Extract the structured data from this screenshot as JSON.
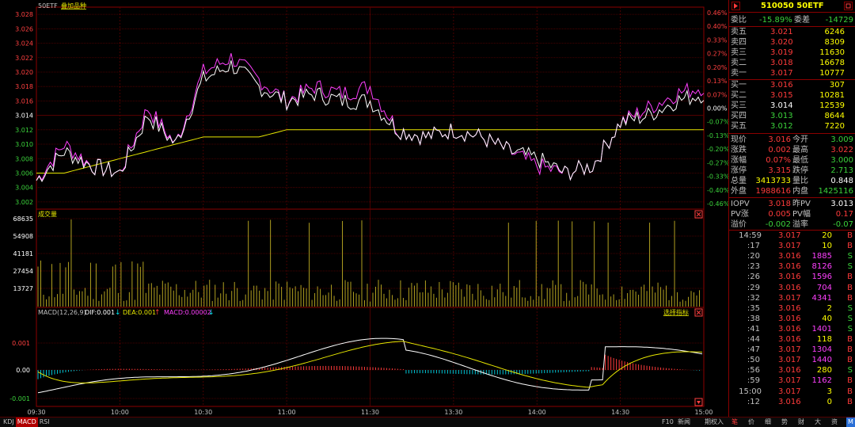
{
  "chart_header": {
    "code": "50ETF",
    "overlay_label": "叠加品种"
  },
  "volume_title": "成交量",
  "macd_title": "MACD(12,26,9)",
  "dif_label": "DIF:0.001",
  "dea_label": "DEA:0.001",
  "macd_label": "MACD:0.00002",
  "indicator_select": "选择指标",
  "price_axis": [
    "3.028",
    "3.026",
    "3.024",
    "3.022",
    "3.020",
    "3.018",
    "3.016",
    "3.014",
    "3.012",
    "3.010",
    "3.008",
    "3.006",
    "3.004",
    "3.002"
  ],
  "pct_axis": [
    "0.46%",
    "0.40%",
    "0.33%",
    "0.27%",
    "0.20%",
    "0.13%",
    "0.07%",
    "0.00%",
    "-0.07%",
    "-0.13%",
    "-0.20%",
    "-0.27%",
    "-0.33%",
    "-0.40%",
    "-0.46%"
  ],
  "volume_axis": [
    "68635",
    "54908",
    "41181",
    "27454",
    "13727"
  ],
  "macd_axis": [
    "0.001",
    "0.00",
    "-0.001"
  ],
  "time_axis": [
    "09:30",
    "10:00",
    "10:30",
    "11:00",
    "11:30",
    "13:30",
    "14:00",
    "14:30",
    "15:00"
  ],
  "chart_data": {
    "type": "line",
    "x": [
      "09:30",
      "09:40",
      "09:50",
      "10:00",
      "10:10",
      "10:20",
      "10:30",
      "10:40",
      "10:50",
      "11:00",
      "11:10",
      "11:20",
      "11:30",
      "13:10",
      "13:20",
      "13:30",
      "13:40",
      "13:50",
      "14:00",
      "14:10",
      "14:20",
      "14:30",
      "14:40",
      "14:50",
      "15:00"
    ],
    "series": [
      {
        "values": [
          3.005,
          3.009,
          3.007,
          3.006,
          3.014,
          3.01,
          3.019,
          3.021,
          3.018,
          3.016,
          3.017,
          3.016,
          3.016,
          3.012,
          3.011,
          3.012,
          3.011,
          3.009,
          3.008,
          3.006,
          3.007,
          3.013,
          3.014,
          3.016,
          3.017
        ]
      },
      {
        "values": [
          3.005,
          3.01,
          3.007,
          3.006,
          3.015,
          3.01,
          3.02,
          3.022,
          3.019,
          3.016,
          3.018,
          3.017,
          3.018,
          3.012,
          3.011,
          3.012,
          3.011,
          3.009,
          3.007,
          3.006,
          3.007,
          3.013,
          3.015,
          3.017,
          3.018
        ]
      },
      {
        "values": [
          3.006,
          3.006,
          3.007,
          3.008,
          3.009,
          3.01,
          3.011,
          3.011,
          3.011,
          3.012,
          3.012,
          3.012,
          3.012,
          3.012,
          3.012,
          3.012,
          3.012,
          3.012,
          3.012,
          3.012,
          3.012,
          3.012,
          3.012,
          3.012,
          3.012
        ]
      }
    ],
    "ylim": [
      3.001,
      3.029
    ]
  },
  "quote": {
    "code_name": "510050 50ETF",
    "weibi_label": "委比",
    "weibi_value": "-15.89%",
    "weicha_label": "委差",
    "weicha_value": "-14729",
    "asks": [
      {
        "label": "卖五",
        "price": "3.021",
        "vol": "6246"
      },
      {
        "label": "卖四",
        "price": "3.020",
        "vol": "8309"
      },
      {
        "label": "卖三",
        "price": "3.019",
        "vol": "11630"
      },
      {
        "label": "卖二",
        "price": "3.018",
        "vol": "16678"
      },
      {
        "label": "卖一",
        "price": "3.017",
        "vol": "10777"
      }
    ],
    "bids": [
      {
        "label": "买一",
        "price": "3.016",
        "vol": "307"
      },
      {
        "label": "买二",
        "price": "3.015",
        "vol": "10281"
      },
      {
        "label": "买三",
        "price": "3.014",
        "vol": "12539"
      },
      {
        "label": "买四",
        "price": "3.013",
        "vol": "8644"
      },
      {
        "label": "买五",
        "price": "3.012",
        "vol": "7220"
      }
    ],
    "stats": [
      {
        "l1": "现价",
        "v1": "3.016",
        "l2": "今开",
        "v2": "3.009"
      },
      {
        "l1": "涨跌",
        "v1": "0.002",
        "l2": "最高",
        "v2": "3.022"
      },
      {
        "l1": "涨幅",
        "v1": "0.07%",
        "l2": "最低",
        "v2": "3.000"
      },
      {
        "l1": "涨停",
        "v1": "3.315",
        "l2": "跌停",
        "v2": "2.713"
      },
      {
        "l1": "总量",
        "v1": "3413733",
        "l2": "量比",
        "v2": "0.848"
      },
      {
        "l1": "外盘",
        "v1": "1988616",
        "l2": "内盘",
        "v2": "1425116"
      }
    ],
    "iopv": [
      {
        "l1": "IOPV",
        "v1": "3.018",
        "l2": "昨PV",
        "v2": "3.013"
      },
      {
        "l1": "PV涨",
        "v1": "0.005",
        "l2": "PV幅",
        "v2": "0.17"
      },
      {
        "l1": "溢价",
        "v1": "-0.002",
        "l2": "溢率",
        "v2": "-0.07"
      }
    ],
    "ticks": [
      {
        "t": "14:59",
        "p": "3.017",
        "v": "20",
        "s": "B"
      },
      {
        "t": ":17",
        "p": "3.017",
        "v": "10",
        "s": "B"
      },
      {
        "t": ":20",
        "p": "3.016",
        "v": "1885",
        "s": "S"
      },
      {
        "t": ":23",
        "p": "3.016",
        "v": "8126",
        "s": "S"
      },
      {
        "t": ":26",
        "p": "3.016",
        "v": "1596",
        "s": "B"
      },
      {
        "t": ":29",
        "p": "3.016",
        "v": "704",
        "s": "B"
      },
      {
        "t": ":32",
        "p": "3.017",
        "v": "4341",
        "s": "B"
      },
      {
        "t": ":35",
        "p": "3.016",
        "v": "2",
        "s": "S"
      },
      {
        "t": ":38",
        "p": "3.016",
        "v": "40",
        "s": "S"
      },
      {
        "t": ":41",
        "p": "3.016",
        "v": "1401",
        "s": "S"
      },
      {
        "t": ":44",
        "p": "3.016",
        "v": "118",
        "s": "B"
      },
      {
        "t": ":47",
        "p": "3.017",
        "v": "1304",
        "s": "B"
      },
      {
        "t": ":50",
        "p": "3.017",
        "v": "1440",
        "s": "B"
      },
      {
        "t": ":56",
        "p": "3.016",
        "v": "280",
        "s": "S"
      },
      {
        "t": ":59",
        "p": "3.017",
        "v": "1162",
        "s": "B"
      },
      {
        "t": "15:00",
        "p": "3.017",
        "v": "3",
        "s": "B"
      },
      {
        "t": ":12",
        "p": "3.016",
        "v": "0",
        "s": "B"
      }
    ]
  },
  "status_bar": {
    "left_tabs": [
      "KDJ",
      "MACD",
      "RSI"
    ],
    "f10": "F10",
    "news": "新闻",
    "options": "期权入",
    "right_tabs": [
      "笔",
      "价",
      "细",
      "势",
      "财",
      "大",
      "资",
      "M"
    ]
  }
}
